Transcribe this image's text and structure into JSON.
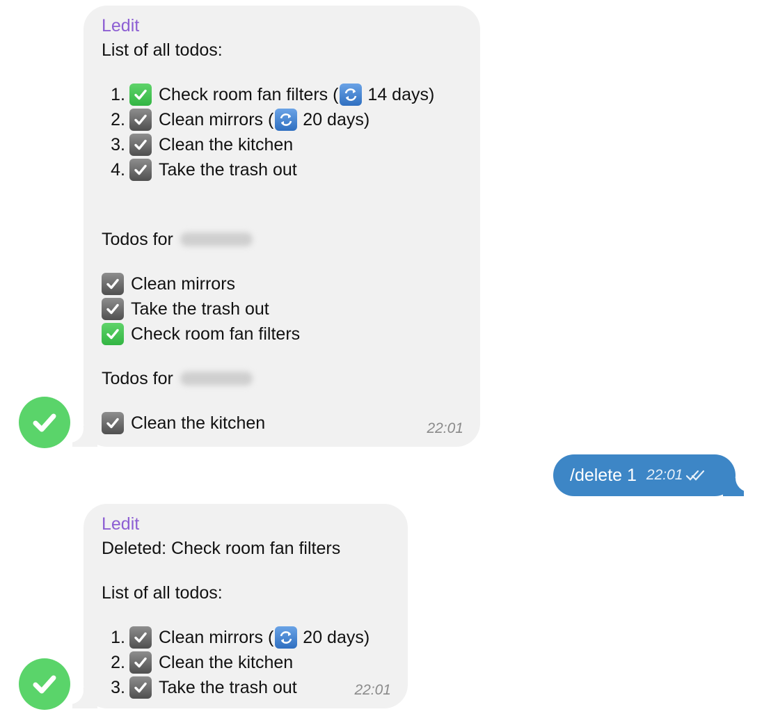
{
  "chat": {
    "message1": {
      "sender": "Ledit",
      "intro": "List of all todos:",
      "items": [
        {
          "num": "1.",
          "checked_icon": "green-check",
          "text": "Check room fan filters (",
          "repeat": "14 days)"
        },
        {
          "num": "2.",
          "checked_icon": "grey-check",
          "text": "Clean mirrors (",
          "repeat": "20 days)"
        },
        {
          "num": "3.",
          "checked_icon": "grey-check",
          "text": "Clean the kitchen"
        },
        {
          "num": "4.",
          "checked_icon": "grey-check",
          "text": "Take the trash out"
        }
      ],
      "group1_label": "Todos for",
      "group1_items": [
        "Clean mirrors",
        "Take the trash out",
        "Check room fan filters"
      ],
      "group2_label": "Todos for",
      "group2_items": [
        "Clean the kitchen"
      ],
      "time": "22:01"
    },
    "message2": {
      "text": "/delete 1",
      "time": "22:01"
    },
    "message3": {
      "sender": "Ledit",
      "deleted": "Deleted: Check room fan filters",
      "intro": "List of all todos:",
      "items": [
        {
          "num": "1.",
          "text": "Clean mirrors (",
          "repeat": "20 days)"
        },
        {
          "num": "2.",
          "text": "Clean the kitchen"
        },
        {
          "num": "3.",
          "text": "Take the trash out"
        }
      ],
      "time": "22:01"
    }
  },
  "colors": {
    "sender": "#8d5fd3",
    "incoming_bubble": "#f1f1f1",
    "outgoing_bubble": "#3d86c6",
    "avatar": "#5ad46a"
  }
}
